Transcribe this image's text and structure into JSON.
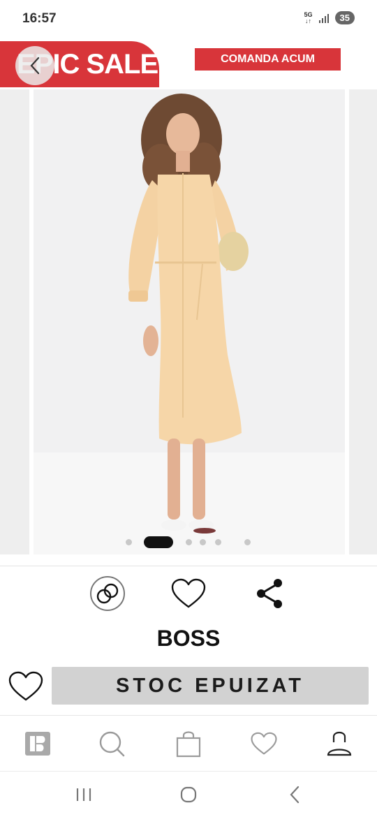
{
  "status_bar": {
    "time": "16:57",
    "network": "5G",
    "battery": "35"
  },
  "promo": {
    "sale_label": "EPIC SALE",
    "order_label": "COMANDA ACUM"
  },
  "gallery": {
    "slide_count": 6,
    "active_index": 1
  },
  "actions": {
    "compare_icon": "compare-rings-icon",
    "wishlist_icon": "heart-outline-icon",
    "share_icon": "share-icon"
  },
  "product": {
    "brand": "BOSS"
  },
  "buy": {
    "status_label": "STOC EPUIZAT"
  },
  "bottom_nav": {
    "items": [
      {
        "icon": "app-logo-icon"
      },
      {
        "icon": "search-icon"
      },
      {
        "icon": "shopping-bag-icon"
      },
      {
        "icon": "heart-icon"
      },
      {
        "icon": "account-icon"
      }
    ]
  },
  "colors": {
    "accent": "#d8353a",
    "disabled_button": "#d2d2d2",
    "dress": "#f6d6a8"
  }
}
